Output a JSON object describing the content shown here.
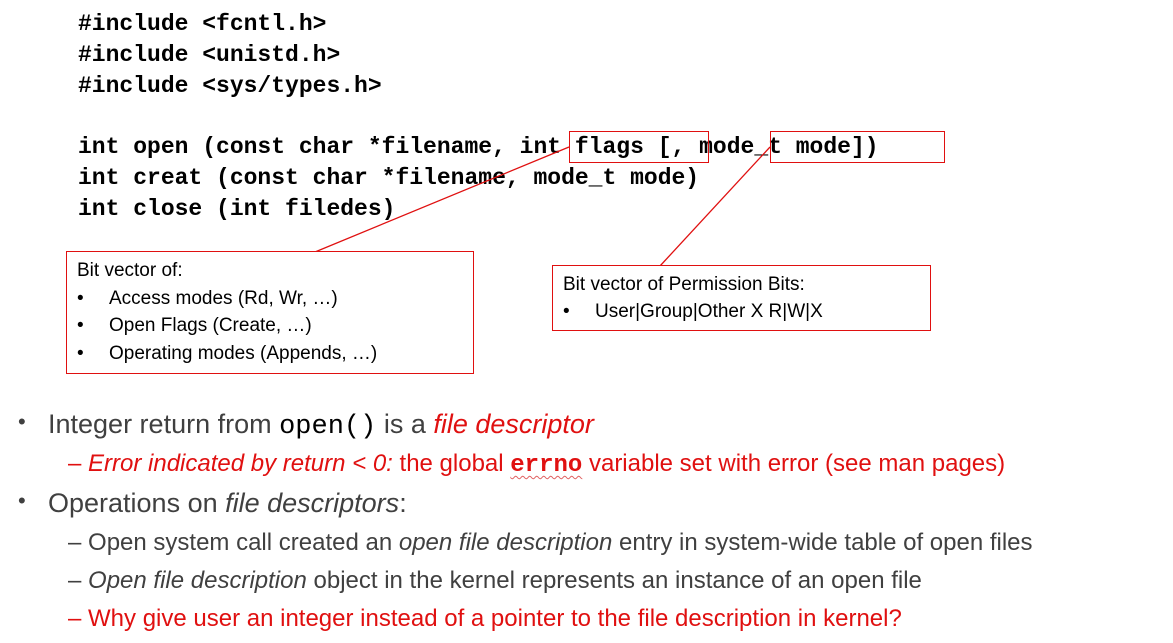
{
  "code": {
    "include1": "#include <fcntl.h>",
    "include2": "#include <unistd.h>",
    "include3": "#include <sys/types.h>",
    "open_a": "int open (const char *filename, ",
    "open_b": "int flags",
    "open_c": " [, ",
    "open_d": "mode_t mode",
    "open_e": "])",
    "creat": "int creat (const char *filename, mode_t mode)",
    "close": "int close (int filedes)"
  },
  "callout_flags": {
    "heading": "Bit vector of:",
    "items": [
      "Access modes (Rd, Wr, …)",
      "Open Flags (Create, …)",
      "Operating modes (Appends, …)"
    ]
  },
  "callout_mode": {
    "heading": "Bit vector of Permission Bits:",
    "items": [
      "User|Group|Other X R|W|X"
    ]
  },
  "bullets": {
    "b1_pre": "Integer return from ",
    "b1_code": "open()",
    "b1_mid": " is a ",
    "b1_em": "file descriptor",
    "b1_sub_em": "Error indicated by return < 0:",
    "b1_sub_pre": " the global ",
    "b1_sub_code": "errno",
    "b1_sub_post": " variable set with error (see man pages)",
    "b2_pre": "Operations on ",
    "b2_em": "file descriptors",
    "b2_post": ":",
    "s1_pre": "Open system call created an ",
    "s1_em": "open file description",
    "s1_post": " entry in system-wide table of open files",
    "s2_em": "Open file description",
    "s2_post": " object in the kernel represents an instance of an open file",
    "s3": "Why give user an integer instead of a pointer to the file description in kernel?"
  },
  "glyphs": {
    "bullet": "•",
    "dash": "–"
  },
  "colors": {
    "accent": "#e01010",
    "body_text": "#404040",
    "code_text": "#000000"
  }
}
